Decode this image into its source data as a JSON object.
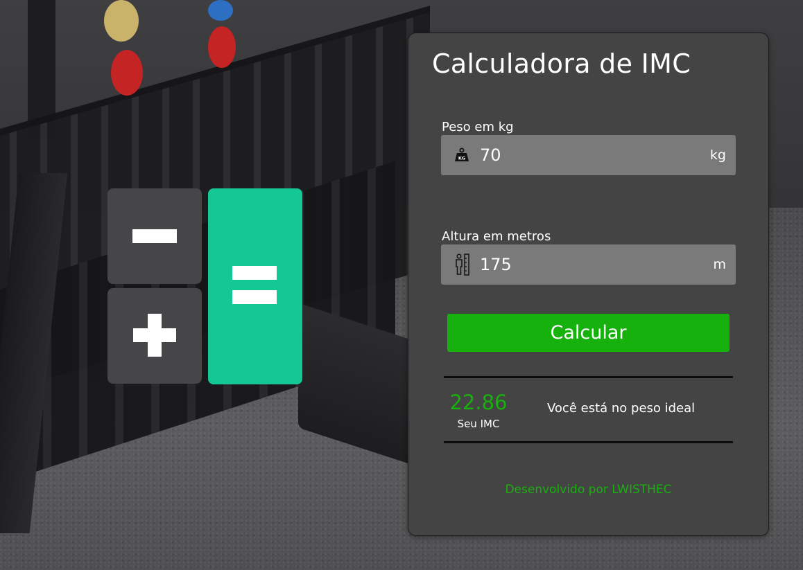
{
  "card": {
    "title": "Calculadora de IMC",
    "weight": {
      "label": "Peso em kg",
      "value": "70",
      "unit": "kg",
      "icon": "weight-kg-icon"
    },
    "height": {
      "label": "Altura em metros",
      "value": "175",
      "unit": "m",
      "icon": "person-height-icon"
    },
    "calculate_label": "Calcular",
    "result": {
      "value": "22.86",
      "label": "Seu IMC",
      "message": "Você está no peso ideal"
    },
    "footer": "Desenvolvido por LWISTHEC"
  },
  "logo": {
    "blocks": [
      "minus",
      "plus",
      "equal"
    ]
  },
  "colors": {
    "card_bg": "#444444",
    "input_bg": "#7a7a7a",
    "button": "#17b10e",
    "accent_text": "#17b10e",
    "logo_dark": "#464548",
    "logo_green": "#14c896"
  }
}
